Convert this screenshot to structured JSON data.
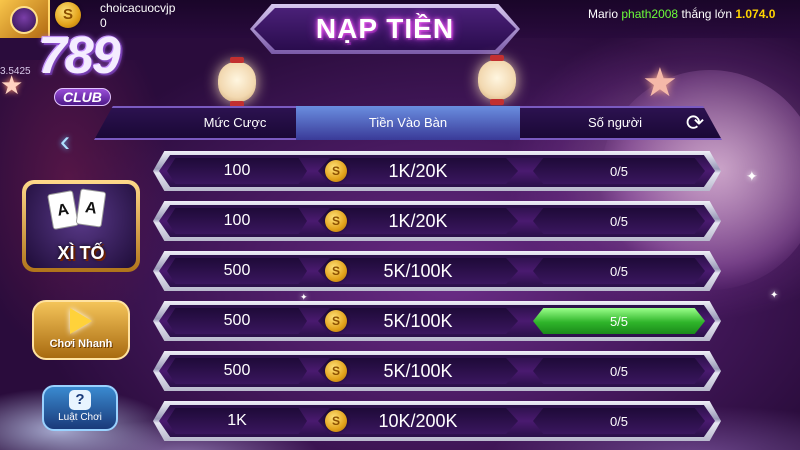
{
  "header": {
    "username": "choicacuocvjp",
    "balance": "0",
    "side_id": "3.5425",
    "coin_symbol": "S",
    "ticker": {
      "name": "Mario",
      "winner": "phath2008",
      "verb": "thắng lớn",
      "amount": "1.074.0"
    }
  },
  "logo": {
    "number": "789",
    "club": "CLUB"
  },
  "title": "NẠP TIỀN",
  "table": {
    "columns": [
      "Mức Cược",
      "Tiền Vào Bàn",
      "Số người"
    ],
    "active_column": "Tiền Vào Bàn",
    "rows": [
      {
        "bet": "100",
        "money": "1K/20K",
        "players": "0/5",
        "full": false
      },
      {
        "bet": "100",
        "money": "1K/20K",
        "players": "0/5",
        "full": false
      },
      {
        "bet": "500",
        "money": "5K/100K",
        "players": "0/5",
        "full": false
      },
      {
        "bet": "500",
        "money": "5K/100K",
        "players": "5/5",
        "full": true
      },
      {
        "bet": "500",
        "money": "5K/100K",
        "players": "0/5",
        "full": false
      },
      {
        "bet": "1K",
        "money": "10K/200K",
        "players": "0/5",
        "full": false
      }
    ]
  },
  "sidebar": {
    "back_icon": "chevron-left-icon",
    "game_card_label": "XÌ TỐ",
    "cards": [
      "A",
      "A"
    ],
    "quick_play_label": "Chơi Nhanh",
    "rules_label": "Luật Chơi",
    "rules_icon_glyph": "?"
  },
  "icons": {
    "refresh": "refresh-icon",
    "coin": "coin-icon"
  },
  "colors": {
    "winner": "#6cff3a",
    "amount": "#ffd400",
    "full_badge": "#2fb52a"
  }
}
